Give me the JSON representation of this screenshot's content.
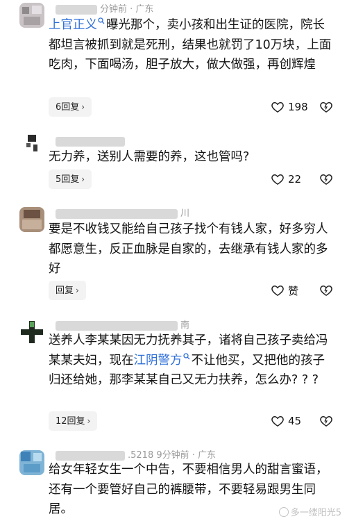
{
  "comments": [
    {
      "meta": "分钟前 · 广东",
      "mention": "上官正义",
      "text": "曝光那个，卖小孩和出生证的医院，院长都坦言被抓到就是死刑，结果也就罚了10万块，上面吃肉，下面喝汤，胆子放大，做大做强，再创辉煌",
      "reply_label": "6回复",
      "likes": "198"
    },
    {
      "meta": "",
      "text": "无力养，送别人需要的养，这也管吗?",
      "reply_label": "5回复",
      "likes": "22"
    },
    {
      "meta": "川",
      "text": "要是不收钱又能给自己孩子找个有钱人家，好多穷人都愿意生，反正血脉是自家的，去继承有钱人家的多好",
      "reply_label": "回复",
      "likes": "赞"
    },
    {
      "meta": "南",
      "text_before": "送养人李某某因无力抚养其子，诸将自己孩子卖给冯某某夫妇，现在",
      "mention": "江阴警方",
      "text_after": "不让他买，又把他的孩子归还给她，那李某某自己又无力扶养，怎么办? ? ?",
      "reply_label": "12回复",
      "likes": "45"
    },
    {
      "meta": "9分钟前 · 广东",
      "meta_prefix": ".5218",
      "text": "给女年轻女生一个中告，不要相信男人的甜言蜜语，还有一个要管好自己的裤腰带，不要轻易跟男生同居。"
    }
  ],
  "watermark": "多一缕阳光5",
  "colors": {
    "mention": "#2f6fd8",
    "reply_bg": "#f3f3f3",
    "meta": "#9a9a9a"
  }
}
